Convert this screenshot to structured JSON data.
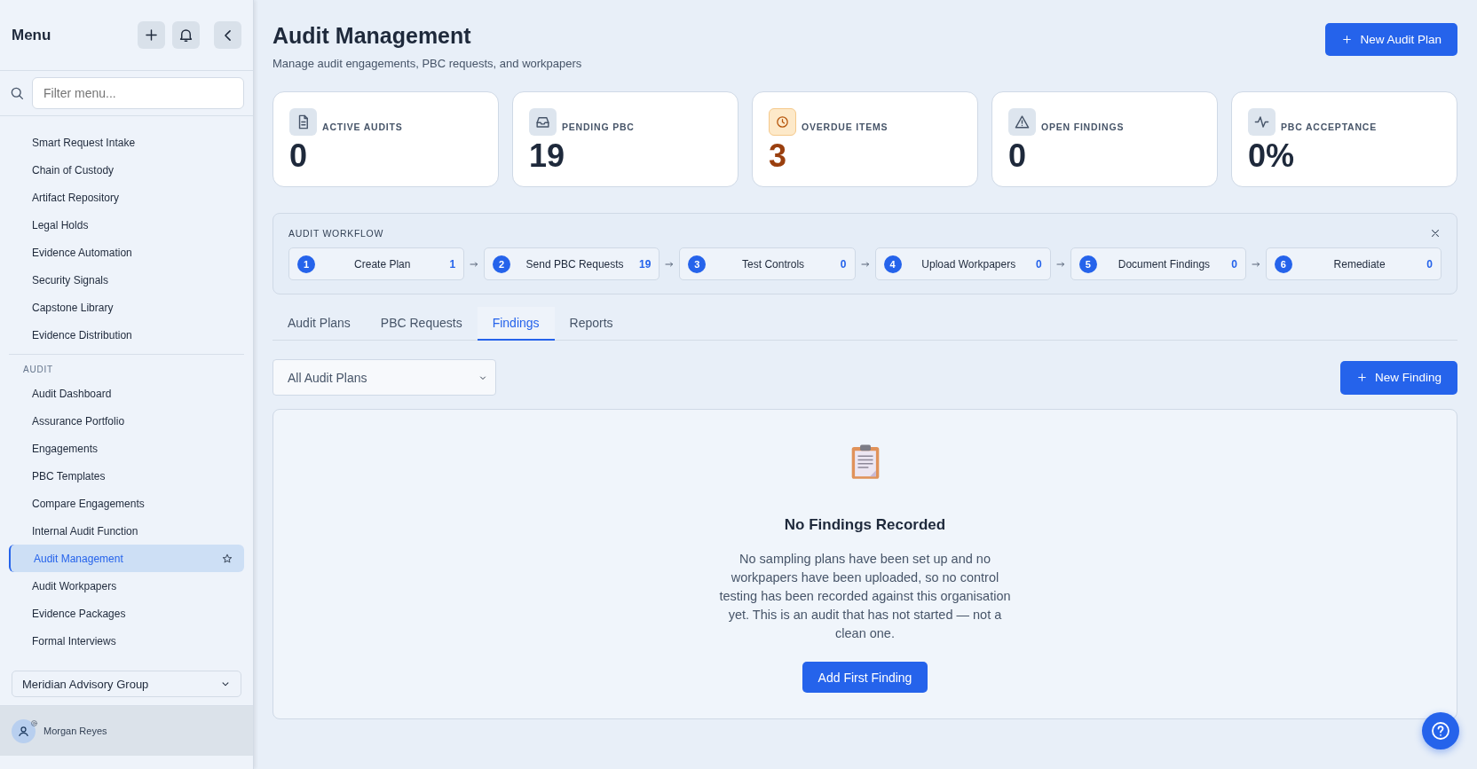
{
  "sidebar": {
    "title": "Menu",
    "filter": {
      "placeholder": "Filter menu..."
    },
    "groups": [
      {
        "items": [
          {
            "label": "Smart Request Intake",
            "selected": false
          },
          {
            "label": "Chain of Custody",
            "selected": false
          },
          {
            "label": "Artifact Repository",
            "selected": false
          },
          {
            "label": "Legal Holds",
            "selected": false
          },
          {
            "label": "Evidence Automation",
            "selected": false
          },
          {
            "label": "Security Signals",
            "selected": false
          },
          {
            "label": "Capstone Library",
            "selected": false
          },
          {
            "label": "Evidence Distribution",
            "selected": false
          }
        ]
      },
      {
        "heading": "AUDIT",
        "items": [
          {
            "label": "Audit Dashboard",
            "selected": false
          },
          {
            "label": "Assurance Portfolio",
            "selected": false
          },
          {
            "label": "Engagements",
            "selected": false
          },
          {
            "label": "PBC Templates",
            "selected": false
          },
          {
            "label": "Compare Engagements",
            "selected": false
          },
          {
            "label": "Internal Audit Function",
            "selected": false
          },
          {
            "label": "Audit Management",
            "selected": true
          },
          {
            "label": "Audit Workpapers",
            "selected": false
          },
          {
            "label": "Evidence Packages",
            "selected": false
          },
          {
            "label": "Formal Interviews",
            "selected": false
          }
        ]
      }
    ],
    "organization": "Meridian Advisory Group",
    "user": "Morgan Reyes"
  },
  "header": {
    "title": "Audit Management",
    "subtitle": "Manage audit engagements, PBC requests, and workpapers",
    "action": "New Audit Plan"
  },
  "stats": [
    {
      "label": "ACTIVE AUDITS",
      "value": "0",
      "kind": "normal"
    },
    {
      "label": "PENDING PBC",
      "value": "19",
      "kind": "normal"
    },
    {
      "label": "OVERDUE ITEMS",
      "value": "3",
      "kind": "warning"
    },
    {
      "label": "OPEN FINDINGS",
      "value": "0",
      "kind": "normal"
    },
    {
      "label": "PBC ACCEPTANCE",
      "value": "0%",
      "kind": "normal"
    }
  ],
  "workflow": {
    "title": "AUDIT WORKFLOW",
    "steps": [
      {
        "number": "1",
        "label": "Create Plan",
        "count": "1"
      },
      {
        "number": "2",
        "label": "Send PBC Requests",
        "count": "19"
      },
      {
        "number": "3",
        "label": "Test Controls",
        "count": "0"
      },
      {
        "number": "4",
        "label": "Upload Workpapers",
        "count": "0"
      },
      {
        "number": "5",
        "label": "Document Findings",
        "count": "0"
      },
      {
        "number": "6",
        "label": "Remediate",
        "count": "0"
      }
    ]
  },
  "tabs": [
    {
      "label": "Audit Plans",
      "selected": false
    },
    {
      "label": "PBC Requests",
      "selected": false
    },
    {
      "label": "Findings",
      "selected": true
    },
    {
      "label": "Reports",
      "selected": false
    }
  ],
  "plan_filter": {
    "value": "All Audit Plans"
  },
  "new_finding": "New Finding",
  "empty_state": {
    "title": "No Findings Recorded",
    "message": "No sampling plans have been set up and no workpapers have been uploaded, so no control testing has been recorded against this organisation yet. This is an audit that has not started — not a clean one.",
    "action": "Add First Finding"
  }
}
